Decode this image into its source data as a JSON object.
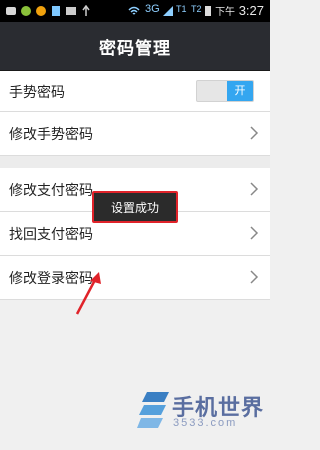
{
  "status_bar": {
    "network": "3G",
    "sim1_label": "T1",
    "sim2_label": "T2",
    "time_prefix": "下午",
    "time": "3:27"
  },
  "header": {
    "title": "密码管理"
  },
  "section1": {
    "gesture_password_label": "手势密码",
    "gesture_toggle_label": "开",
    "change_gesture_label": "修改手势密码"
  },
  "section2": {
    "change_payment_label": "修改支付密码",
    "recover_payment_label": "找回支付密码",
    "change_login_label": "修改登录密码"
  },
  "toast": {
    "message": "设置成功"
  },
  "watermark": {
    "brand": "手机世界",
    "sub": "3533.com"
  },
  "colors": {
    "title_bar": "#2a2c31",
    "toggle_on": "#34a6f0",
    "highlight": "#e0232a"
  }
}
